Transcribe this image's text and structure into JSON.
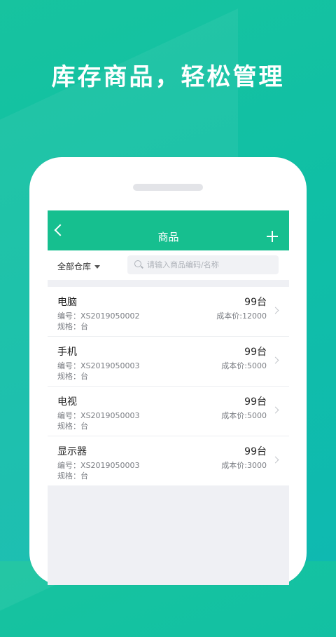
{
  "headline": "库存商品，轻松管理",
  "navbar": {
    "title": "商品"
  },
  "filter": {
    "warehouse": "全部仓库",
    "search_placeholder": "请输入商品编码/名称"
  },
  "products": [
    {
      "name": "电脑",
      "code": "编号：XS2019050002",
      "spec": "规格：台",
      "qty": "99台",
      "cost": "成本价:12000"
    },
    {
      "name": "手机",
      "code": "编号：XS2019050003",
      "spec": "规格：台",
      "qty": "99台",
      "cost": "成本价:5000"
    },
    {
      "name": "电视",
      "code": "编号：XS2019050003",
      "spec": "规格：台",
      "qty": "99台",
      "cost": "成本价:5000"
    },
    {
      "name": "显示器",
      "code": "编号：XS2019050003",
      "spec": "规格：台",
      "qty": "99台",
      "cost": "成本价:3000"
    }
  ],
  "colors": {
    "brand": "#16bf8f",
    "background": "#12c0a6"
  }
}
